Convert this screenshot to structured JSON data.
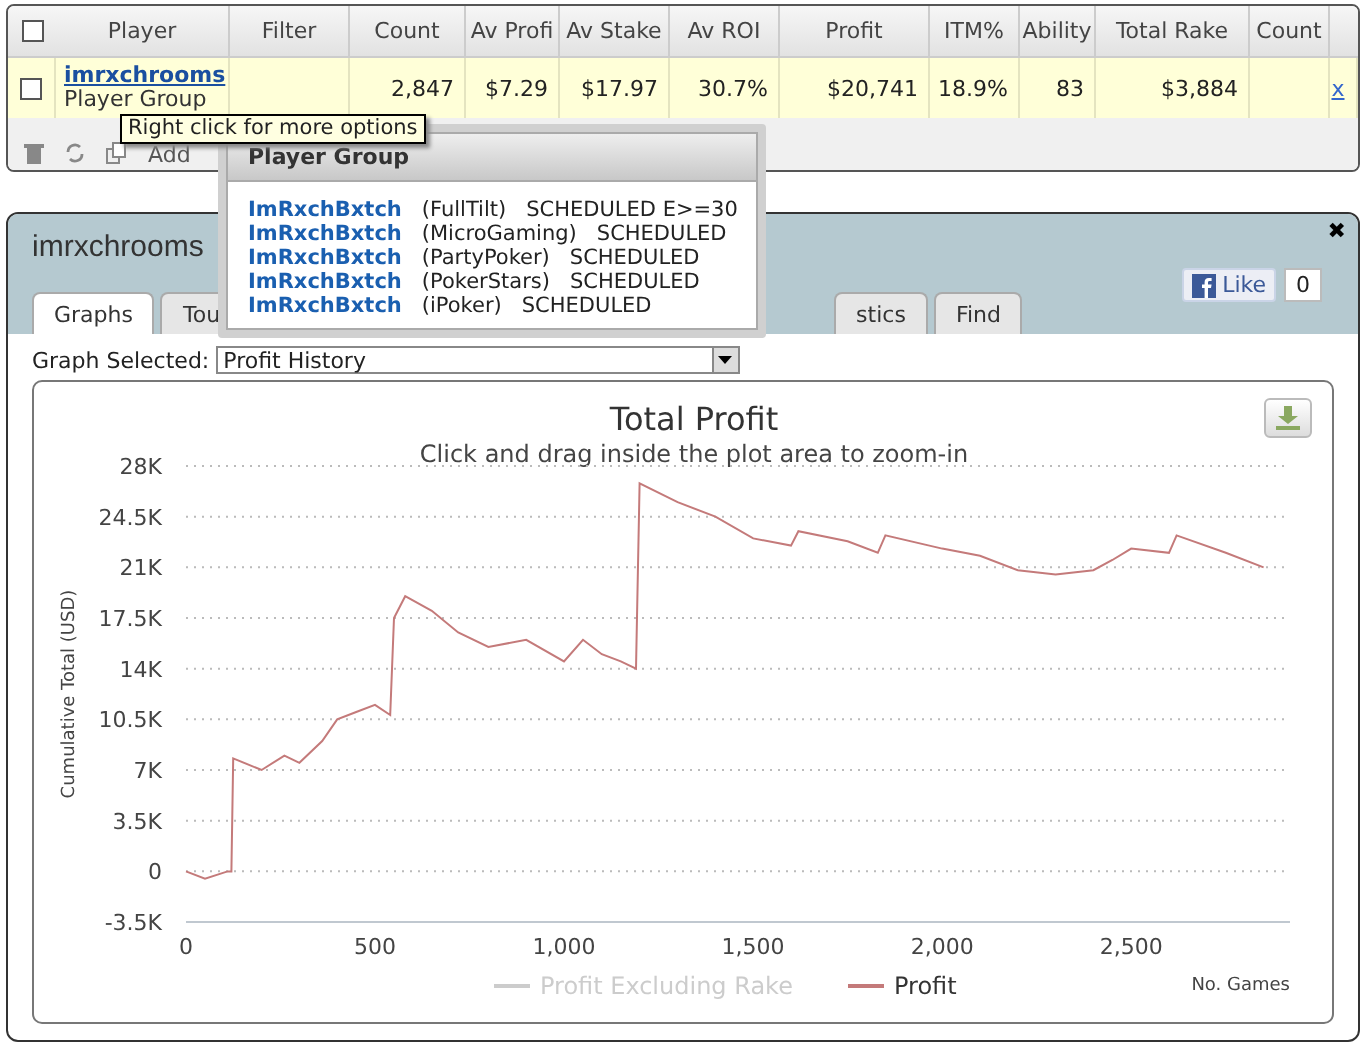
{
  "grid": {
    "columns": [
      "Player",
      "Filter",
      "Count",
      "Av Profi",
      "Av Stake",
      "Av ROI",
      "Profit",
      "ITM%",
      "Ability",
      "Total Rake",
      "Count"
    ],
    "all_checked": false,
    "rows": [
      {
        "checked": false,
        "cells": [
          {
            "link": "imrxchrooms",
            "sub": "Player Group"
          },
          {
            "text": ""
          },
          {
            "text": "2,847"
          },
          {
            "text": "$7.29"
          },
          {
            "text": "$17.97"
          },
          {
            "text": "30.7%"
          },
          {
            "text": "$20,741"
          },
          {
            "text": "18.9%"
          },
          {
            "text": "83"
          },
          {
            "text": "$3,884"
          },
          {
            "text": ""
          }
        ],
        "remove": "x"
      }
    ],
    "toolbar": {
      "add_label": "Add"
    }
  },
  "tooltip": "Right click for more options",
  "popup": {
    "title": "Player Group",
    "items": [
      {
        "name": "ImRxchBxtch",
        "site": "(FullTilt)",
        "status": "SCHEDULED E>=30"
      },
      {
        "name": "ImRxchBxtch",
        "site": "(MicroGaming)",
        "status": "SCHEDULED"
      },
      {
        "name": "ImRxchBxtch",
        "site": "(PartyPoker)",
        "status": "SCHEDULED"
      },
      {
        "name": "ImRxchBxtch",
        "site": "(PokerStars)",
        "status": "SCHEDULED"
      },
      {
        "name": "ImRxchBxtch",
        "site": "(iPoker)",
        "status": "SCHEDULED"
      }
    ]
  },
  "panel": {
    "title": "imrxchrooms",
    "close": "✖",
    "like": {
      "label": "Like",
      "count": "0"
    },
    "tabs": [
      {
        "label": "Graphs",
        "selected": true
      },
      {
        "label": "Tou",
        "selected": false
      },
      {
        "label": "stics",
        "selected": false
      },
      {
        "label": "Find",
        "selected": false
      }
    ],
    "graph_select": {
      "label": "Graph Selected:",
      "value": "Profit History"
    },
    "chart_data": {
      "type": "line",
      "title": "Total Profit",
      "subtitle": "Click and drag inside the plot area to zoom-in",
      "xlabel": "No. Games",
      "ylabel": "Cumulative Total (USD)",
      "x": [
        0,
        50,
        110,
        120,
        125,
        200,
        260,
        300,
        360,
        400,
        450,
        500,
        540,
        550,
        580,
        650,
        720,
        800,
        900,
        1000,
        1050,
        1100,
        1150,
        1190,
        1200,
        1300,
        1400,
        1500,
        1600,
        1620,
        1750,
        1830,
        1850,
        2000,
        2100,
        2200,
        2300,
        2400,
        2450,
        2500,
        2600,
        2620,
        2750,
        2850
      ],
      "series": [
        {
          "name": "Profit Excluding Rake",
          "color": "#cccccc",
          "values": [
            null,
            null,
            null,
            null,
            null,
            null,
            null,
            null,
            null,
            null,
            null,
            null,
            null,
            null,
            null,
            null,
            null,
            null,
            null,
            null,
            null,
            null,
            null,
            null,
            null,
            null,
            null,
            null,
            null,
            null,
            null,
            null,
            null,
            null,
            null,
            null,
            null,
            null,
            null,
            null,
            null,
            null,
            null,
            null
          ]
        },
        {
          "name": "Profit",
          "color": "#c47a7a",
          "values": [
            0,
            -500,
            0,
            0,
            7800,
            7000,
            8000,
            7500,
            9000,
            10500,
            11000,
            11500,
            10800,
            17500,
            19000,
            18000,
            16500,
            15500,
            16000,
            14500,
            16000,
            15000,
            14500,
            14000,
            26800,
            25500,
            24500,
            23000,
            22500,
            23500,
            22800,
            22000,
            23200,
            22300,
            21800,
            20800,
            20500,
            20800,
            21500,
            22300,
            22000,
            23200,
            22000,
            21000
          ]
        }
      ],
      "grid": true,
      "xlim": [
        0,
        2920
      ],
      "ylim": [
        -3500,
        28000
      ],
      "xticks": [
        {
          "value": 0,
          "label": "0"
        },
        {
          "value": 500,
          "label": "500"
        },
        {
          "value": 1000,
          "label": "1,000"
        },
        {
          "value": 1500,
          "label": "1,500"
        },
        {
          "value": 2000,
          "label": "2,000"
        },
        {
          "value": 2500,
          "label": "2,500"
        }
      ],
      "yticks": [
        {
          "value": -3500,
          "label": "-3.5K"
        },
        {
          "value": 0,
          "label": "0"
        },
        {
          "value": 3500,
          "label": "3.5K"
        },
        {
          "value": 7000,
          "label": "7K"
        },
        {
          "value": 10500,
          "label": "10.5K"
        },
        {
          "value": 14000,
          "label": "14K"
        },
        {
          "value": 17500,
          "label": "17.5K"
        },
        {
          "value": 21000,
          "label": "21K"
        },
        {
          "value": 24500,
          "label": "24.5K"
        },
        {
          "value": 28000,
          "label": "28K"
        }
      ]
    }
  }
}
